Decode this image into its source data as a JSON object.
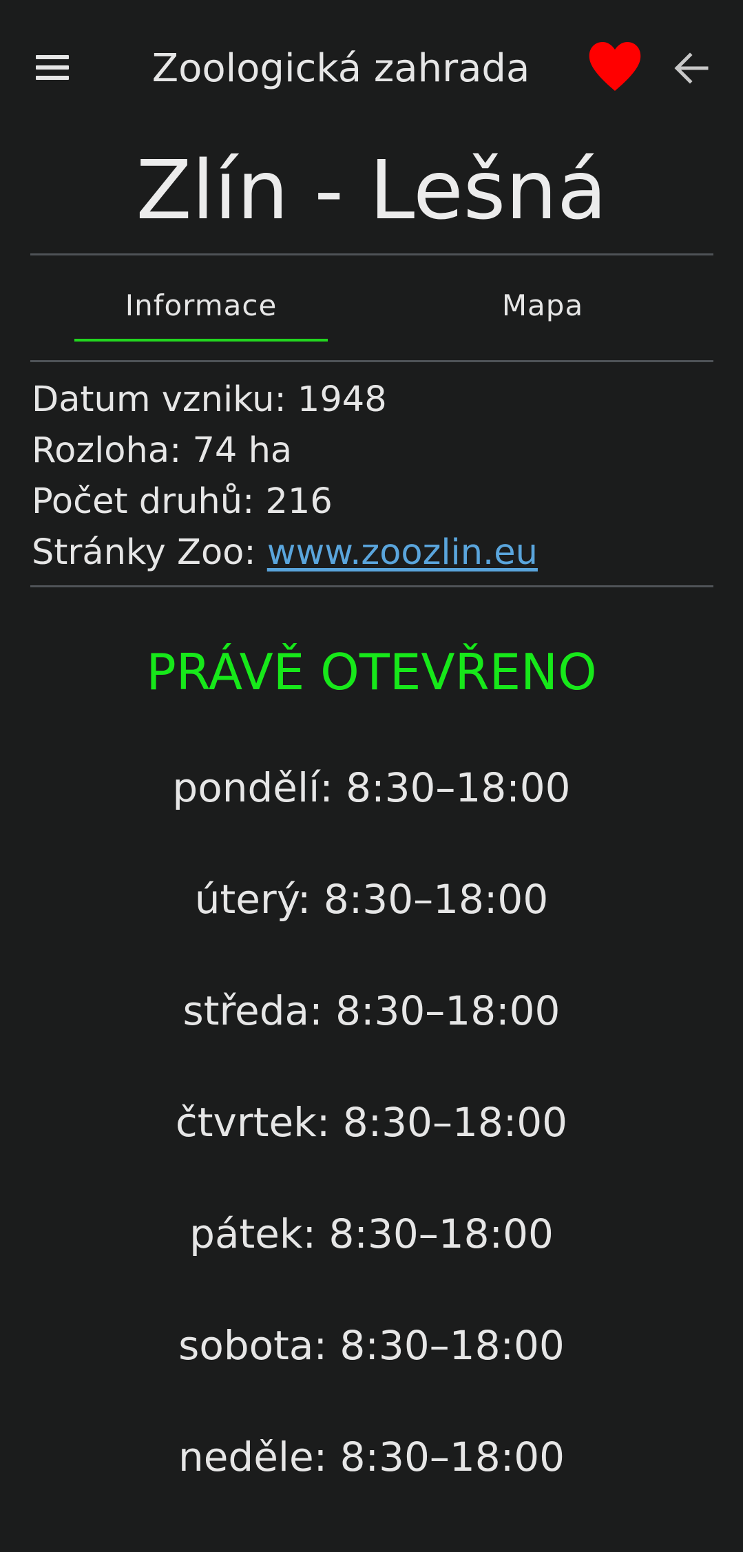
{
  "app_bar": {
    "title": "Zoologická zahrada",
    "menu_icon": "hamburger-menu-icon",
    "favorite_icon": "heart-icon",
    "back_icon": "arrow-back-icon",
    "favorite_color": "#ff0000"
  },
  "zoo": {
    "name": "Zlín - Lešná"
  },
  "tabs": [
    {
      "label": "Informace",
      "active": true
    },
    {
      "label": "Mapa",
      "active": false
    }
  ],
  "info": {
    "founded_label": "Datum vzniku: ",
    "founded_value": "1948",
    "area_label": "Rozloha: ",
    "area_value": "74 ha",
    "species_label": "Počet druhů: ",
    "species_value": "216",
    "website_label": "Stránky Zoo: ",
    "website_value": "www.zoozlin.eu"
  },
  "status": {
    "text": "PRÁVĚ OTEVŘENO",
    "color": "#17e81a"
  },
  "opening_hours": [
    {
      "text": "pondělí: 8:30–18:00"
    },
    {
      "text": "úterý: 8:30–18:00"
    },
    {
      "text": "středa: 8:30–18:00"
    },
    {
      "text": "čtvrtek: 8:30–18:00"
    },
    {
      "text": "pátek: 8:30–18:00"
    },
    {
      "text": "sobota: 8:30–18:00"
    },
    {
      "text": "neděle: 8:30–18:00"
    }
  ],
  "colors": {
    "background": "#1b1c1c",
    "tab_indicator": "#22d61f",
    "link": "#5aa5dc"
  }
}
